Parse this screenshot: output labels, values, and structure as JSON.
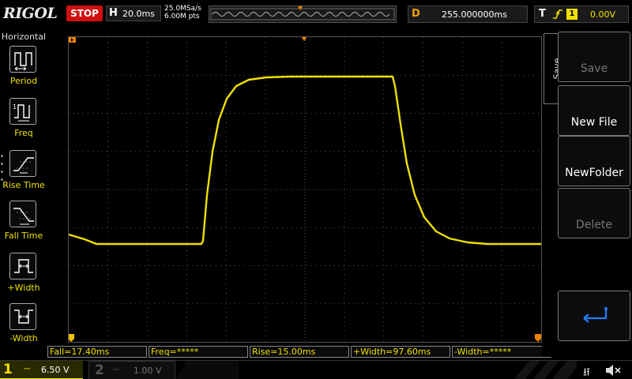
{
  "header": {
    "brand": "RIGOL",
    "run_state": "STOP",
    "horizontal_label": "H",
    "horizontal_scale": "20.0ms",
    "sample_rate": "25.0MSa/s",
    "memory_depth": "6.00M pts",
    "delay_label": "D",
    "delay_value": "255.000000ms",
    "trigger_label": "T",
    "trigger_source": "1",
    "trigger_level": "0.00V"
  },
  "left_menu": {
    "title": "Horizontal",
    "items": [
      {
        "label": "Period",
        "icon": "period-icon"
      },
      {
        "label": "Freq",
        "icon": "freq-icon"
      },
      {
        "label": "Rise Time",
        "icon": "rise-time-icon"
      },
      {
        "label": "Fall Time",
        "icon": "fall-time-icon"
      },
      {
        "label": "+Width",
        "icon": "positive-width-icon"
      },
      {
        "label": "-Width",
        "icon": "negative-width-icon"
      }
    ]
  },
  "measurements": [
    {
      "label": "Fall=17.40ms"
    },
    {
      "label": "Freq=*****"
    },
    {
      "label": "Rise=15.00ms"
    },
    {
      "label": "+Width=97.60ms"
    },
    {
      "label": "-Width=*****"
    }
  ],
  "channels": {
    "ch1": {
      "number": "1",
      "scale": "6.50 V",
      "color": "#f0e000"
    },
    "ch2": {
      "number": "2",
      "scale": "1.00 V",
      "color": "#555555"
    }
  },
  "right_menu": {
    "tab_label": "Save",
    "buttons": [
      {
        "label": "Save",
        "enabled": false
      },
      {
        "label": "New File",
        "enabled": true
      },
      {
        "label": "NewFolder",
        "enabled": true
      },
      {
        "label": "Delete",
        "enabled": false
      }
    ],
    "back_icon": "return-arrow-icon"
  },
  "colors": {
    "trace": "#f0e000",
    "stop": "#d01010",
    "accent_blue": "#2080ff",
    "marker_orange": "#f08000"
  }
}
